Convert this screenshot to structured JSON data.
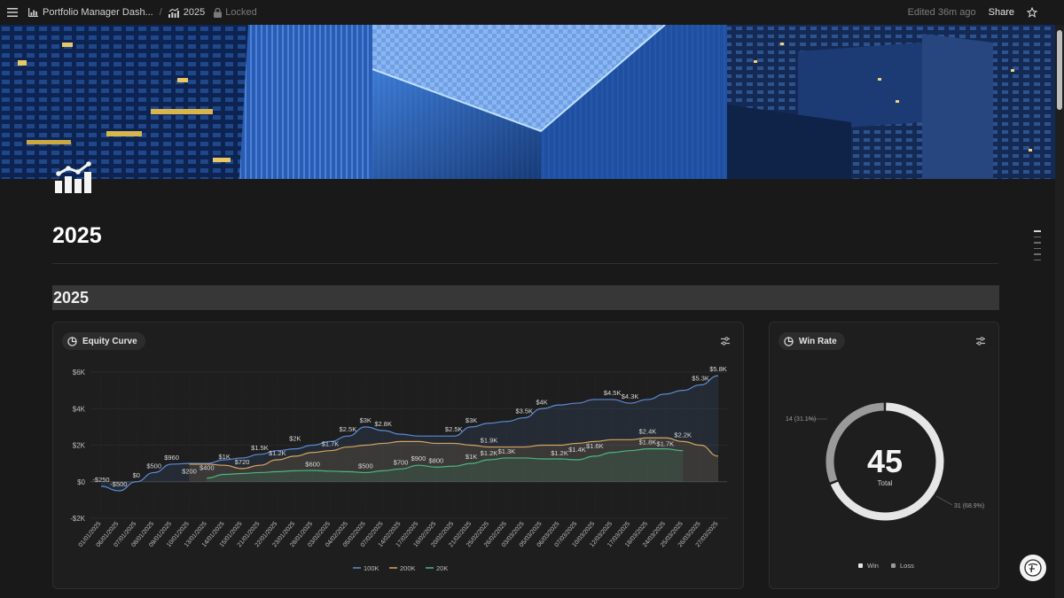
{
  "topbar": {
    "breadcrumb_parent": "Portfolio Manager Dash...",
    "breadcrumb_current": "2025",
    "locked_label": "Locked",
    "edited_label": "Edited 36m ago",
    "share_label": "Share"
  },
  "page": {
    "title": "2025",
    "section_heading": "2025"
  },
  "equity_card": {
    "label": "Equity Curve"
  },
  "winrate_card": {
    "label": "Win Rate"
  },
  "colors": {
    "series_100k": "#5b8bd6",
    "series_200k": "#d9a45c",
    "series_20k": "#4cb67d",
    "win": "#e6e6e6",
    "loss": "#9a9a9a"
  },
  "chart_data": [
    {
      "type": "line",
      "title": "",
      "ylim": [
        -2000,
        6000
      ],
      "y_ticks": [
        "$6K",
        "$4K",
        "$2K",
        "$0",
        "-$2K"
      ],
      "y_tick_values": [
        6000,
        4000,
        2000,
        0,
        -2000
      ],
      "x": [
        "01/01/2025",
        "06/01/2025",
        "07/01/2025",
        "08/01/2025",
        "09/01/2025",
        "10/01/2025",
        "13/01/2025",
        "14/01/2025",
        "15/01/2025",
        "21/01/2025",
        "22/01/2025",
        "23/01/2025",
        "28/01/2025",
        "03/02/2025",
        "04/02/2025",
        "05/02/2025",
        "07/02/2025",
        "14/02/2025",
        "17/02/2025",
        "18/02/2025",
        "20/02/2025",
        "21/02/2025",
        "25/02/2025",
        "26/02/2025",
        "03/03/2025",
        "05/03/2025",
        "06/03/2025",
        "07/03/2025",
        "10/03/2025",
        "12/03/2025",
        "17/03/2025",
        "18/03/2025",
        "24/03/2025",
        "25/03/2025",
        "26/03/2025",
        "27/03/2025"
      ],
      "grid": true,
      "legend_position": "bottom",
      "series": [
        {
          "name": "100K",
          "color": "#5b8bd6",
          "values": [
            -250,
            -500,
            0,
            500,
            960,
            1000,
            1000,
            1200,
            1300,
            1500,
            1700,
            1800,
            2000,
            2200,
            2500,
            3000,
            2800,
            2600,
            2500,
            2500,
            2500,
            3000,
            3200,
            3300,
            3500,
            4000,
            4200,
            4300,
            4500,
            4500,
            4300,
            4500,
            4800,
            5000,
            5300,
            5800
          ]
        },
        {
          "name": "200K",
          "color": "#d9a45c",
          "values": [
            null,
            null,
            null,
            null,
            null,
            960,
            960,
            900,
            720,
            900,
            1200,
            1400,
            1600,
            1700,
            1900,
            2000,
            2100,
            2200,
            2200,
            2100,
            2100,
            2000,
            1900,
            1900,
            1900,
            2000,
            2000,
            2100,
            2200,
            2300,
            2300,
            2400,
            2400,
            2200,
            2000,
            1400
          ]
        },
        {
          "name": "20K",
          "color": "#4cb67d",
          "values": [
            null,
            null,
            null,
            null,
            null,
            null,
            200,
            400,
            450,
            500,
            550,
            600,
            620,
            580,
            550,
            500,
            600,
            700,
            900,
            800,
            850,
            1000,
            1200,
            1300,
            1300,
            1250,
            1250,
            1200,
            1400,
            1600,
            1700,
            1800,
            1800,
            1700,
            null,
            null
          ]
        }
      ],
      "data_labels": [
        {
          "text": "-$250",
          "x": 0,
          "y": -250
        },
        {
          "text": "-$500",
          "x": 1,
          "y": -500
        },
        {
          "text": "$0",
          "x": 2,
          "y": 0
        },
        {
          "text": "$500",
          "x": 3,
          "y": 500
        },
        {
          "text": "$960",
          "x": 4,
          "y": 960
        },
        {
          "text": "$200",
          "x": 5,
          "y": 200
        },
        {
          "text": "$400",
          "x": 6,
          "y": 400
        },
        {
          "text": "$1K",
          "x": 7,
          "y": 1000
        },
        {
          "text": "$720",
          "x": 8,
          "y": 720
        },
        {
          "text": "$1.5K",
          "x": 9,
          "y": 1500
        },
        {
          "text": "$1.2K",
          "x": 10,
          "y": 1200
        },
        {
          "text": "$2K",
          "x": 11,
          "y": 2000
        },
        {
          "text": "$600",
          "x": 12,
          "y": 600
        },
        {
          "text": "$1.7K",
          "x": 13,
          "y": 1700
        },
        {
          "text": "$2.5K",
          "x": 14,
          "y": 2500
        },
        {
          "text": "$500",
          "x": 15,
          "y": 500
        },
        {
          "text": "$3K",
          "x": 15,
          "y": 3000
        },
        {
          "text": "$2.8K",
          "x": 16,
          "y": 2800
        },
        {
          "text": "$700",
          "x": 17,
          "y": 700
        },
        {
          "text": "$900",
          "x": 18,
          "y": 900
        },
        {
          "text": "$800",
          "x": 19,
          "y": 800
        },
        {
          "text": "$2.5K",
          "x": 20,
          "y": 2500
        },
        {
          "text": "$3K",
          "x": 21,
          "y": 3000
        },
        {
          "text": "$1K",
          "x": 21,
          "y": 1000
        },
        {
          "text": "$1.9K",
          "x": 22,
          "y": 1900
        },
        {
          "text": "$1.2K",
          "x": 22,
          "y": 1200
        },
        {
          "text": "$1.3K",
          "x": 23,
          "y": 1300
        },
        {
          "text": "$3.5K",
          "x": 24,
          "y": 3500
        },
        {
          "text": "$4K",
          "x": 25,
          "y": 4000
        },
        {
          "text": "$1.2K",
          "x": 26,
          "y": 1200
        },
        {
          "text": "$1.4K",
          "x": 27,
          "y": 1400
        },
        {
          "text": "$1.6K",
          "x": 28,
          "y": 1600
        },
        {
          "text": "$4.5K",
          "x": 29,
          "y": 4500
        },
        {
          "text": "$4.3K",
          "x": 30,
          "y": 4300
        },
        {
          "text": "$2.4K",
          "x": 31,
          "y": 2400
        },
        {
          "text": "$1.8K",
          "x": 31,
          "y": 1800
        },
        {
          "text": "$1.7K",
          "x": 32,
          "y": 1700
        },
        {
          "text": "$2.2K",
          "x": 33,
          "y": 2200
        },
        {
          "text": "$5.3K",
          "x": 34,
          "y": 5300
        },
        {
          "text": "$5.8K",
          "x": 35,
          "y": 5800
        }
      ]
    },
    {
      "type": "pie",
      "title": "",
      "center_value": "45",
      "center_label": "Total",
      "slices": [
        {
          "name": "Win",
          "value": 31,
          "label": "31 (68.9%)",
          "color": "#e6e6e6"
        },
        {
          "name": "Loss",
          "value": 14,
          "label": "14 (31.1%)",
          "color": "#9a9a9a"
        }
      ],
      "legend_position": "bottom"
    }
  ]
}
